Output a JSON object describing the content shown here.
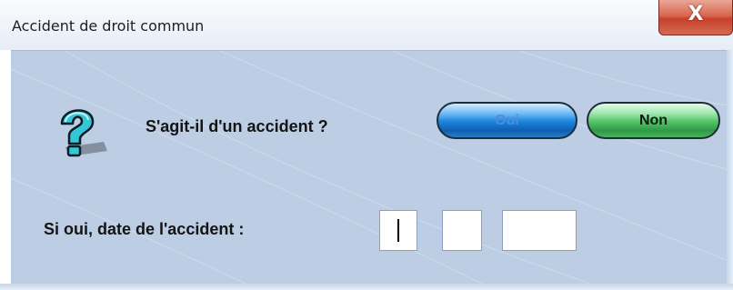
{
  "window": {
    "title": "Accident de droit commun",
    "close_label": "X"
  },
  "dialog": {
    "question": "S'agit-il d'un accident ?",
    "icon": "help-question-icon",
    "yes_button": "Oui",
    "no_button": "Non",
    "date_label": "Si oui, date de l'accident :",
    "date": {
      "day": "",
      "month": "",
      "year": ""
    }
  },
  "colors": {
    "panel_bg": "#bccde4",
    "yes_button": "#1f86df",
    "no_button": "#55c66a",
    "close_button": "#c8412b"
  }
}
